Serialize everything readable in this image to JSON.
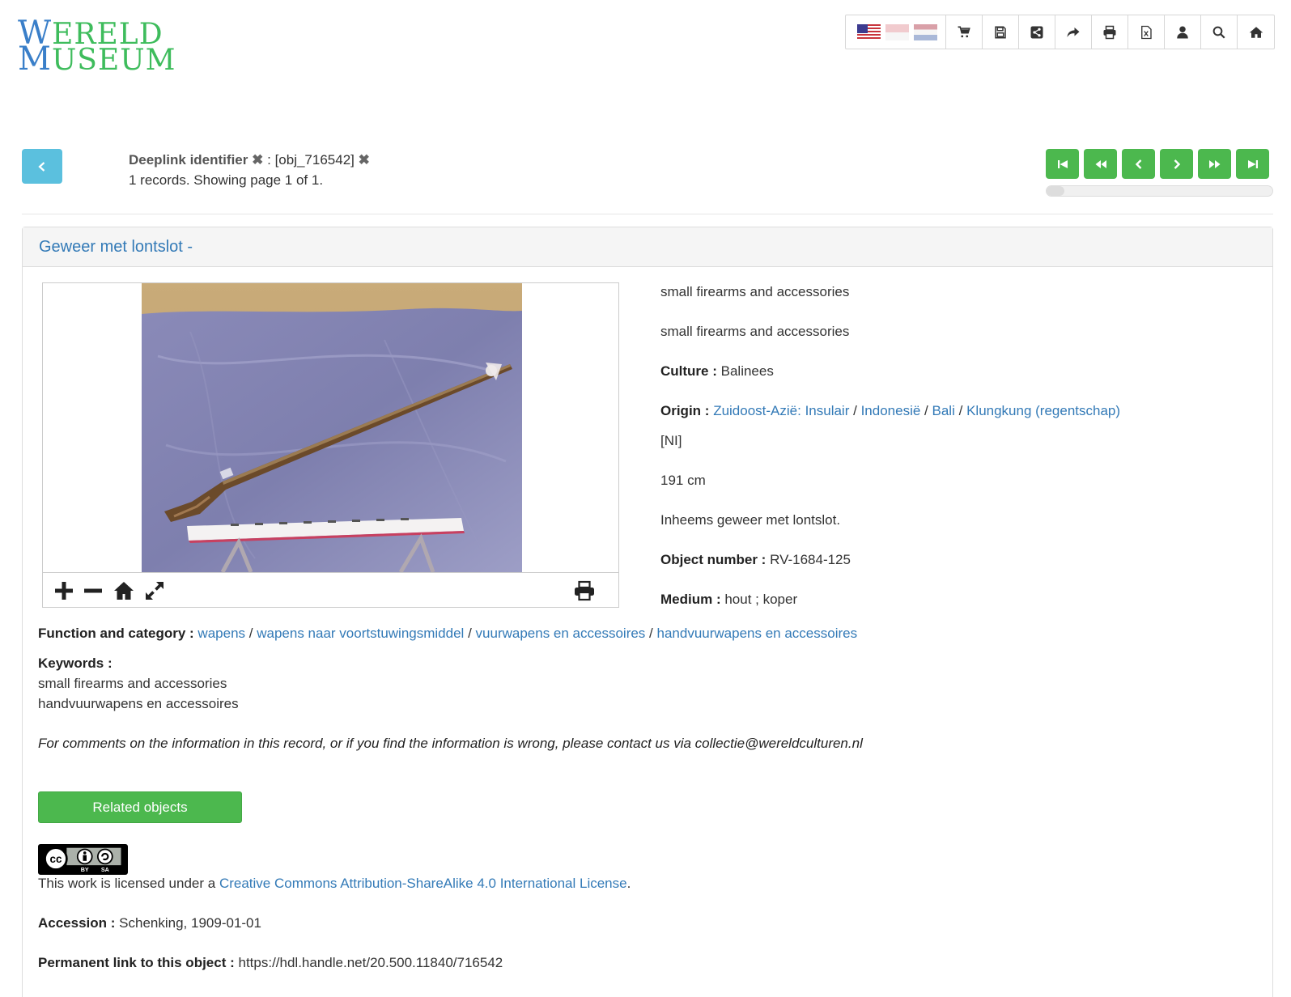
{
  "logo": {
    "line1_first": "W",
    "line1_rest": "ERELD",
    "line2_first": "M",
    "line2_rest": "USEUM"
  },
  "toolbar": {
    "languages": [
      "English",
      "Bahasa Indonesia",
      "Nederlands"
    ],
    "icons": [
      "shopping-cart-icon",
      "save-icon",
      "share-icon",
      "forward-icon",
      "print-icon",
      "excel-icon",
      "user-icon",
      "search-icon",
      "home-icon"
    ]
  },
  "search": {
    "criterion_label": "Deeplink identifier",
    "remove_glyph": "✖",
    "separator": ":",
    "criterion_value": "[obj_716542]",
    "summary": "1 records. Showing page 1 of 1."
  },
  "pager": {
    "progress_fraction": 0.08
  },
  "record": {
    "title": "Geweer met lontslot -",
    "category_1": "small firearms and accessories",
    "category_2": "small firearms and accessories",
    "culture_label": "Culture :",
    "culture_value": "Balinees",
    "origin_label": "Origin :",
    "origin_links": [
      "Zuidoost-Azië: Insulair",
      "Indonesië",
      "Bali",
      "Klungkung (regentschap)"
    ],
    "origin_sep": "/",
    "origin_note": "[NI]",
    "dimension": "191 cm",
    "description": "Inheems geweer met lontslot.",
    "object_number_label": "Object number :",
    "object_number_value": "RV-1684-125",
    "medium_label": "Medium :",
    "medium_value": "hout ; koper",
    "function_label": "Function and category :",
    "function_links": [
      "wapens",
      "wapens naar voortstuwingsmiddel",
      "vuurwapens en accessoires",
      "handvuurwapens en accessoires"
    ],
    "keywords_label": "Keywords :",
    "keywords": [
      "small firearms and accessories",
      "handvuurwapens en accessoires"
    ],
    "comment": "For comments on the information in this record, or if you find the information is wrong, please contact us via collectie@wereldculturen.nl",
    "related_button": "Related objects",
    "license_badge": {
      "cc": "cc",
      "by": "BY",
      "sa": "SA"
    },
    "license_prefix": "This work is licensed under a ",
    "license_link": "Creative Commons Attribution-ShareAlike 4.0 International License",
    "license_suffix": ".",
    "accession_label": "Accession :",
    "accession_value": "Schenking, 1909-01-01",
    "permalink_label": "Permanent link to this object :",
    "permalink_value": "https://hdl.handle.net/20.500.11840/716542"
  },
  "viewer": {
    "controls": [
      "zoom-in-icon",
      "zoom-out-icon",
      "home-icon",
      "fullscreen-icon",
      "print-icon"
    ]
  }
}
